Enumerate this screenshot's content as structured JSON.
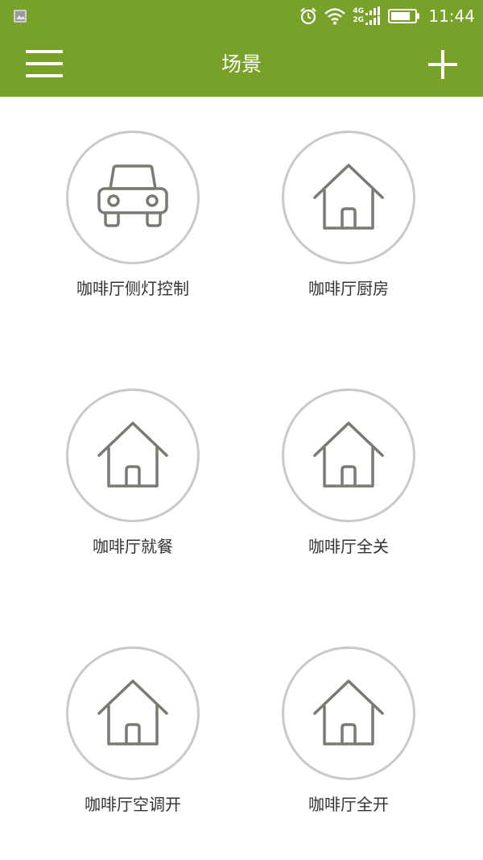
{
  "status_bar": {
    "time": "11:44",
    "net_top": "4G",
    "net_bottom": "2G",
    "icons": [
      "image-notification-icon",
      "alarm-icon",
      "wifi-icon",
      "signal-icon",
      "battery-icon"
    ]
  },
  "header": {
    "title": "场景",
    "menu_icon": "hamburger-menu-icon",
    "add_icon": "plus-icon"
  },
  "colors": {
    "brand": "#78a12a",
    "icon_stroke": "#7a7a72",
    "circle_border": "#c9c9c9",
    "label_text": "#333333"
  },
  "scenes": [
    {
      "label": "咖啡厅侧灯控制",
      "icon": "car-icon"
    },
    {
      "label": "咖啡厅厨房",
      "icon": "house-icon"
    },
    {
      "label": "咖啡厅就餐",
      "icon": "house-icon"
    },
    {
      "label": "咖啡厅全关",
      "icon": "house-icon"
    },
    {
      "label": "咖啡厅空调开",
      "icon": "house-icon"
    },
    {
      "label": "咖啡厅全开",
      "icon": "house-icon"
    }
  ]
}
